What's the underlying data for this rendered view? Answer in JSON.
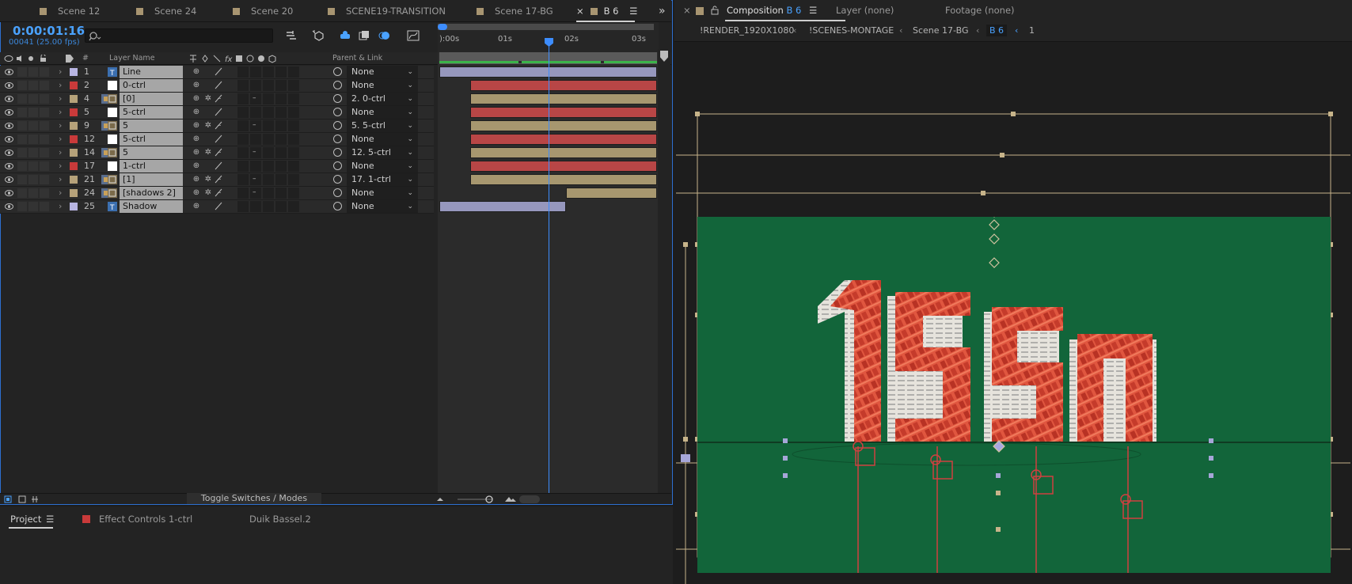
{
  "timeline": {
    "tabs": [
      {
        "label": "Scene 12",
        "color": "#a89571"
      },
      {
        "label": "Scene 24",
        "color": "#a89571"
      },
      {
        "label": "Scene 20",
        "color": "#a89571"
      },
      {
        "label": "SCENE19-TRANSITION",
        "color": "#a89571"
      },
      {
        "label": "Scene 17-BG",
        "color": "#a89571"
      },
      {
        "label": "B 6",
        "color": "#a89571",
        "active": true
      }
    ],
    "close_glyph": "×",
    "menu_glyph": "☰",
    "overflow_glyph": "»",
    "timecode": "0:00:01:16",
    "frames": "00041 (25.00 fps)",
    "search_placeholder": "",
    "columns": {
      "layer_name": "Layer Name",
      "parent_link": "Parent & Link",
      "hash": "#"
    },
    "ruler_ticks": [
      "):00s",
      "01s",
      "02s",
      "03s"
    ],
    "layers": [
      {
        "num": "1",
        "name": "Line",
        "label_color": "#b8b5e2",
        "parent": "None",
        "src": "text",
        "bar": {
          "type": "blue",
          "start": 0.0,
          "end": 1.0
        }
      },
      {
        "num": "2",
        "name": "0-ctrl",
        "label_color": "#c93a3a",
        "parent": "None",
        "src": "solid",
        "bar": {
          "type": "red",
          "start": 0.14,
          "end": 1.0
        }
      },
      {
        "num": "4",
        "name": "[0]",
        "label_color": "#b6a27a",
        "parent": "2. 0-ctrl",
        "src": "comp",
        "bar": {
          "type": "tan",
          "start": 0.14,
          "end": 1.0
        }
      },
      {
        "num": "5",
        "name": "5-ctrl",
        "label_color": "#c93a3a",
        "parent": "None",
        "src": "solid",
        "bar": {
          "type": "red",
          "start": 0.14,
          "end": 1.0
        }
      },
      {
        "num": "9",
        "name": "5",
        "label_color": "#b6a27a",
        "parent": "5. 5-ctrl",
        "src": "comp",
        "bar": {
          "type": "tan",
          "start": 0.14,
          "end": 1.0
        }
      },
      {
        "num": "12",
        "name": "5-ctrl",
        "label_color": "#c93a3a",
        "parent": "None",
        "src": "solid",
        "bar": {
          "type": "red",
          "start": 0.14,
          "end": 1.0
        }
      },
      {
        "num": "14",
        "name": "5",
        "label_color": "#b6a27a",
        "parent": "12. 5-ctrl",
        "src": "comp",
        "bar": {
          "type": "tan",
          "start": 0.14,
          "end": 1.0
        }
      },
      {
        "num": "17",
        "name": "1-ctrl",
        "label_color": "#c93a3a",
        "parent": "None",
        "src": "solid",
        "bar": {
          "type": "red",
          "start": 0.14,
          "end": 1.0
        }
      },
      {
        "num": "21",
        "name": "[1]",
        "label_color": "#b6a27a",
        "parent": "17. 1-ctrl",
        "src": "comp",
        "bar": {
          "type": "tan",
          "start": 0.14,
          "end": 1.0
        }
      },
      {
        "num": "24",
        "name": "[shadows 2]",
        "label_color": "#b6a27a",
        "parent": "None",
        "src": "comp",
        "bar": {
          "type": "tan",
          "start": 0.58,
          "end": 1.0
        }
      },
      {
        "num": "25",
        "name": "Shadow",
        "label_color": "#b8b5e2",
        "parent": "None",
        "src": "text",
        "bar": {
          "type": "blue",
          "start": 0.0,
          "end": 0.58
        }
      }
    ],
    "toggle_label": "Toggle Switches / Modes"
  },
  "bottom_tabs": {
    "project": "Project",
    "effect_controls": "Effect Controls 1-ctrl",
    "duik": "Duik Bassel.2"
  },
  "composition": {
    "tab_prefix": "Composition",
    "tab_name": "B 6",
    "layer_tab": "Layer (none)",
    "footage_tab": "Footage (none)",
    "breadcrumbs": [
      "!RENDER_1920X1080",
      "!SCENES-MONTAGE",
      "Scene 17-BG",
      "B 6",
      "1"
    ],
    "canvas_text": "15m",
    "bg_color": "#12653a",
    "accent": "#4aa2ff"
  }
}
